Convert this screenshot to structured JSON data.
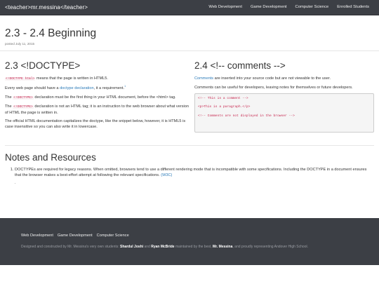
{
  "navbar": {
    "brand": "<teacher>mr.messina</teacher>",
    "links": [
      "Web Development",
      "Game Development",
      "Computer Science",
      "Enrolled Students"
    ]
  },
  "post": {
    "title": "2.3 - 2.4 Beginning",
    "date": "posted July 11, 2015"
  },
  "left": {
    "heading": "2.3 <!DOCTYPE>",
    "p1_code": "<!DOCTYPE html>",
    "p1_text": " means that the page is written in HTML5.",
    "p2_text": "Every web page should have a ",
    "p2_link": "doctype declaration",
    "p2_end": ", it a requirement.",
    "p2_sup": "1",
    "p3_pre": "The ",
    "p3_code": "<!DOCTYPE>",
    "p3_text": " declaration must be the first thing in your HTML document, before the <html> tag.",
    "p4_pre": "The ",
    "p4_code": "<!DOCTYPE>",
    "p4_text": " declaration is not an HTML tag; it is an instruction to the web browser about what version of HTML the page is written in.",
    "p5_text": "The official HTML documentation capitalizes the doctype, like the snippet below, however, it is HTML5 is case insensitive so you can also write it in lowercase."
  },
  "right": {
    "heading": "2.4 <!-- comments -->",
    "p1_link": "Comments",
    "p1_text": " are inserted into your source code but are not viewable to the user.",
    "p2_text": "Comments can be useful for developers, leaving notes for themselves or future developers.",
    "code_lines": [
      "<!-- This is a comment -->",
      "<p>This is a paragraph.</p>",
      "<!-- Comments are not displayed in the browser -->"
    ]
  },
  "notes": {
    "heading": "Notes and Resources",
    "item1_text": "DOCTYPEs are required for legacy reasons. When omitted, browsers tend to use a different rendering mode that is incompatible with some specifications. Including the DOCTYPE in a document ensures that the browser makes a best-effort attempt at following the relevant specifications. ",
    "item1_link": "(W3C)",
    "item2": "."
  },
  "footer": {
    "links": [
      "Web Development",
      "Game Development",
      "Computer Science"
    ],
    "credit_1": "Designed and constructed by Mr. Messina's very own students: ",
    "student_1": "Shardul Joshi",
    "credit_2": " and ",
    "student_2": "Ryan McBride",
    "credit_3": " maintained by the best, ",
    "teacher": "Mr. Messina",
    "credit_4": ", and proudly representing Andover High School."
  }
}
